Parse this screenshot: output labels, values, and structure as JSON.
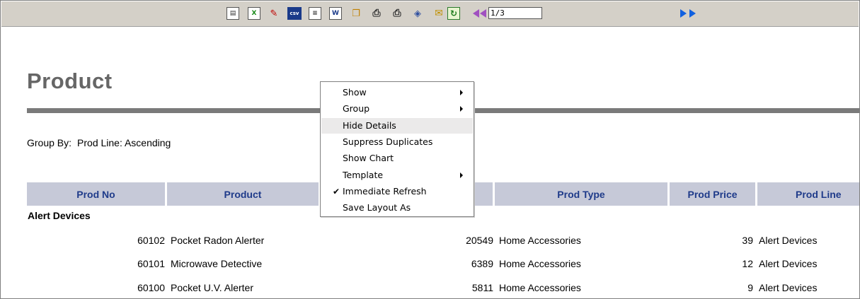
{
  "toolbar": {
    "icons": [
      {
        "name": "page-layout-icon",
        "glyph": "▤"
      },
      {
        "name": "excel-export-icon",
        "glyph": "X"
      },
      {
        "name": "pdf-export-icon",
        "glyph": "✎"
      },
      {
        "name": "csv-export-icon",
        "glyph": "csv"
      },
      {
        "name": "text-document-icon",
        "glyph": "≡"
      },
      {
        "name": "word-export-icon",
        "glyph": "W"
      },
      {
        "name": "copy-icon",
        "glyph": "❐"
      },
      {
        "name": "print-icon",
        "glyph": "⎙"
      },
      {
        "name": "print-all-icon",
        "glyph": "⎙"
      },
      {
        "name": "save-disk-icon",
        "glyph": "◈"
      },
      {
        "name": "email-icon",
        "glyph": "✉"
      },
      {
        "name": "refresh-icon",
        "glyph": "↻"
      }
    ],
    "page_indicator": "1/3"
  },
  "report": {
    "title": "Product",
    "group_by_label": "Group By:",
    "group_by_value": "Prod Line: Ascending"
  },
  "table": {
    "columns": [
      "Prod No",
      "Product",
      "",
      "Prod Type",
      "Prod Price",
      "Prod Line"
    ],
    "group_name": "Alert Devices",
    "rows": [
      {
        "prod_no": "60102",
        "product": "Pocket Radon Alerter",
        "qty": "20549",
        "prod_type": "Home Accessories",
        "prod_price": "39",
        "prod_line": "Alert Devices"
      },
      {
        "prod_no": "60101",
        "product": "Microwave Detective",
        "qty": "6389",
        "prod_type": "Home Accessories",
        "prod_price": "12",
        "prod_line": "Alert Devices"
      },
      {
        "prod_no": "60100",
        "product": "Pocket U.V. Alerter",
        "qty": "5811",
        "prod_type": "Home Accessories",
        "prod_price": "9",
        "prod_line": "Alert Devices"
      }
    ]
  },
  "context_menu": {
    "items": [
      {
        "label": "Show",
        "submenu": true,
        "checked": false,
        "highlighted": false
      },
      {
        "label": "Group",
        "submenu": true,
        "checked": false,
        "highlighted": false
      },
      {
        "label": "Hide Details",
        "submenu": false,
        "checked": false,
        "highlighted": true
      },
      {
        "label": "Suppress Duplicates",
        "submenu": false,
        "checked": false,
        "highlighted": false
      },
      {
        "label": "Show Chart",
        "submenu": false,
        "checked": false,
        "highlighted": false
      },
      {
        "label": "Template",
        "submenu": true,
        "checked": false,
        "highlighted": false
      },
      {
        "label": "Immediate Refresh",
        "submenu": false,
        "checked": true,
        "highlighted": false
      },
      {
        "label": "Save Layout As",
        "submenu": false,
        "checked": false,
        "highlighted": false
      }
    ]
  },
  "colors": {
    "toolbar_bg": "#d4d0c8",
    "header_bg": "#c6c9d8",
    "header_text": "#1f3b8a",
    "title_text": "#666666",
    "rule": "#7a7a7a",
    "nav_prev": "#a050c0",
    "nav_next": "#1060e0"
  }
}
